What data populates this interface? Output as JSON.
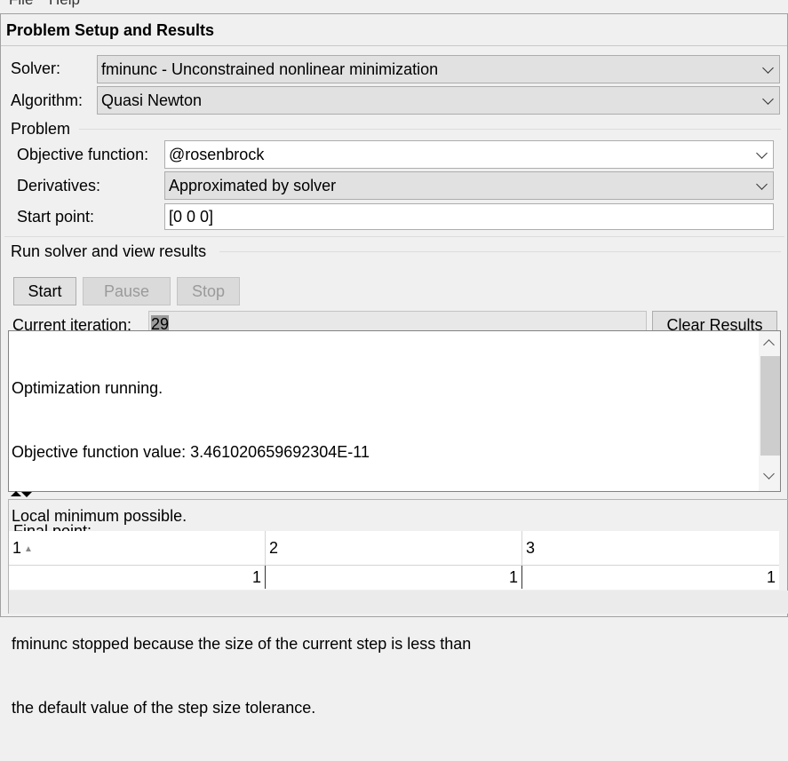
{
  "menu": {
    "file": "File",
    "help": "Help"
  },
  "panel": {
    "title": "Problem Setup and Results"
  },
  "solver": {
    "label": "Solver:",
    "value": "fminunc - Unconstrained nonlinear minimization"
  },
  "algorithm": {
    "label": "Algorithm:",
    "value": "Quasi Newton"
  },
  "problem": {
    "group_title": "Problem",
    "objective_label": "Objective function:",
    "objective_value": "@rosenbrock",
    "derivatives_label": "Derivatives:",
    "derivatives_value": "Approximated by solver",
    "start_label": "Start point:",
    "start_value": "[0 0 0]"
  },
  "run": {
    "group_title": "Run solver and view results",
    "start": "Start",
    "pause": "Pause",
    "stop": "Stop",
    "iteration_label": "Current iteration:",
    "iteration_value": "29",
    "clear": "Clear Results"
  },
  "output": {
    "lines": [
      "Optimization running.",
      "Objective function value: 3.461020659692304E-11",
      "Local minimum possible.",
      "",
      "fminunc stopped because the size of the current step is less than",
      "the default value of the step size tolerance."
    ]
  },
  "final_point": {
    "label": "Final point:",
    "columns": [
      "1",
      "2",
      "3"
    ],
    "values": [
      "1",
      "1",
      "1"
    ]
  },
  "colors": {
    "panel_bg": "#f0f0f0",
    "combo_bg": "#e1e1e1",
    "iteration_highlight": "#9b9b9b"
  },
  "icons": [
    "chevron-down-icon",
    "scroll-up-arrow-icon",
    "scroll-down-arrow-icon",
    "sort-ascending-icon",
    "splitter-arrows-icon"
  ]
}
